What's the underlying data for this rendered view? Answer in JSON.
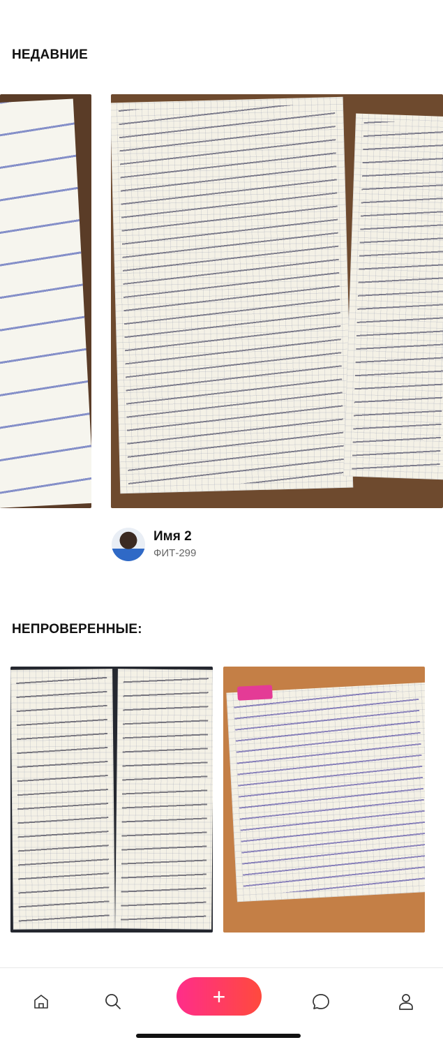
{
  "sections": {
    "recent_title": "НЕДАВНИЕ",
    "unchecked_title": "НЕПРОВЕРЕННЫЕ:"
  },
  "recent_post": {
    "author_name": "Имя 2",
    "author_group": "ФИТ-299"
  },
  "nav": {
    "items": [
      "home-icon",
      "search-icon",
      "add-button",
      "chat-icon",
      "profile-icon"
    ],
    "add_label": "+"
  },
  "colors": {
    "accent_start": "#ff2d8a",
    "accent_end": "#ff4a3d"
  }
}
